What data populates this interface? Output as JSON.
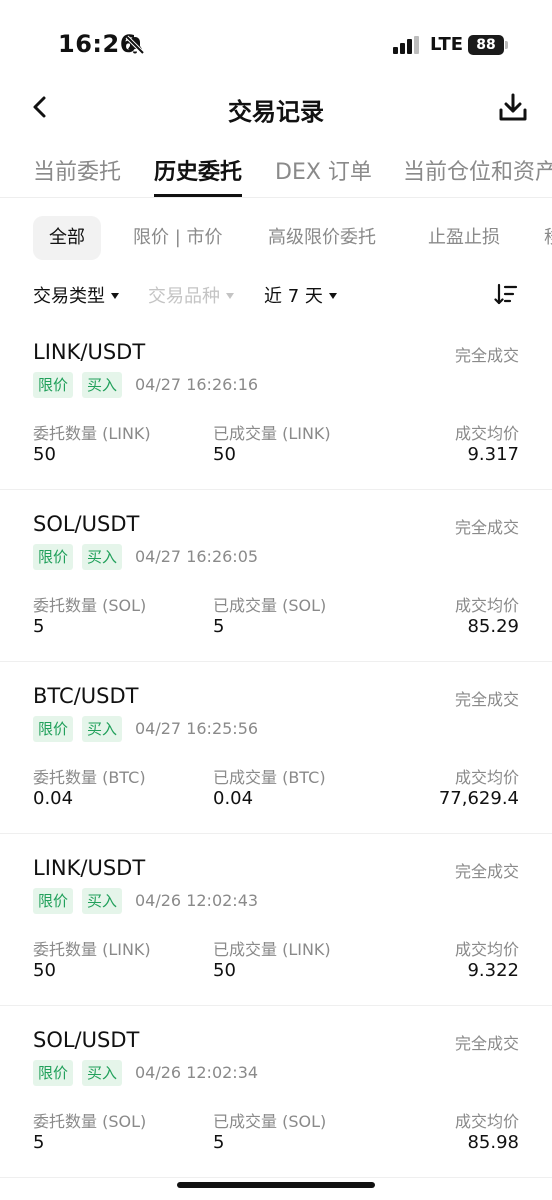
{
  "status_bar": {
    "time": "16:26",
    "network": "LTE",
    "battery": "88"
  },
  "header": {
    "title": "交易记录"
  },
  "main_tabs": [
    {
      "label": "当前委托"
    },
    {
      "label": "历史委托"
    },
    {
      "label": "DEX 订单"
    },
    {
      "label": "当前仓位和资产"
    }
  ],
  "sub_tabs": [
    {
      "label": "全部"
    },
    {
      "label": "限价 | 市价"
    },
    {
      "label": "高级限价委托"
    },
    {
      "label": "止盈止损"
    },
    {
      "label": "移"
    }
  ],
  "filters": {
    "type": "交易类型",
    "symbol": "交易品种",
    "period": "近 7 天"
  },
  "orders": [
    {
      "pair": "LINK/USDT",
      "status": "完全成交",
      "order_type": "限价",
      "side": "买入",
      "time": "04/27 16:26:16",
      "qty_label": "委托数量 (LINK)",
      "qty": "50",
      "filled_label": "已成交量 (LINK)",
      "filled": "50",
      "avg_label": "成交均价",
      "avg": "9.317"
    },
    {
      "pair": "SOL/USDT",
      "status": "完全成交",
      "order_type": "限价",
      "side": "买入",
      "time": "04/27 16:26:05",
      "qty_label": "委托数量 (SOL)",
      "qty": "5",
      "filled_label": "已成交量 (SOL)",
      "filled": "5",
      "avg_label": "成交均价",
      "avg": "85.29"
    },
    {
      "pair": "BTC/USDT",
      "status": "完全成交",
      "order_type": "限价",
      "side": "买入",
      "time": "04/27 16:25:56",
      "qty_label": "委托数量 (BTC)",
      "qty": "0.04",
      "filled_label": "已成交量 (BTC)",
      "filled": "0.04",
      "avg_label": "成交均价",
      "avg": "77,629.4"
    },
    {
      "pair": "LINK/USDT",
      "status": "完全成交",
      "order_type": "限价",
      "side": "买入",
      "time": "04/26 12:02:43",
      "qty_label": "委托数量 (LINK)",
      "qty": "50",
      "filled_label": "已成交量 (LINK)",
      "filled": "50",
      "avg_label": "成交均价",
      "avg": "9.322"
    },
    {
      "pair": "SOL/USDT",
      "status": "完全成交",
      "order_type": "限价",
      "side": "买入",
      "time": "04/26 12:02:34",
      "qty_label": "委托数量 (SOL)",
      "qty": "5",
      "filled_label": "已成交量 (SOL)",
      "filled": "5",
      "avg_label": "成交均价",
      "avg": "85.98"
    }
  ],
  "icons": {
    "back": "chevron-left-icon",
    "download": "download-icon",
    "sort": "sort-icon",
    "mute": "bell-slash-icon",
    "signal": "signal-icon"
  },
  "colors": {
    "tag_bg": "#e5f5ea",
    "tag_text": "#21a05b",
    "muted_text": "#8a8a8a"
  }
}
